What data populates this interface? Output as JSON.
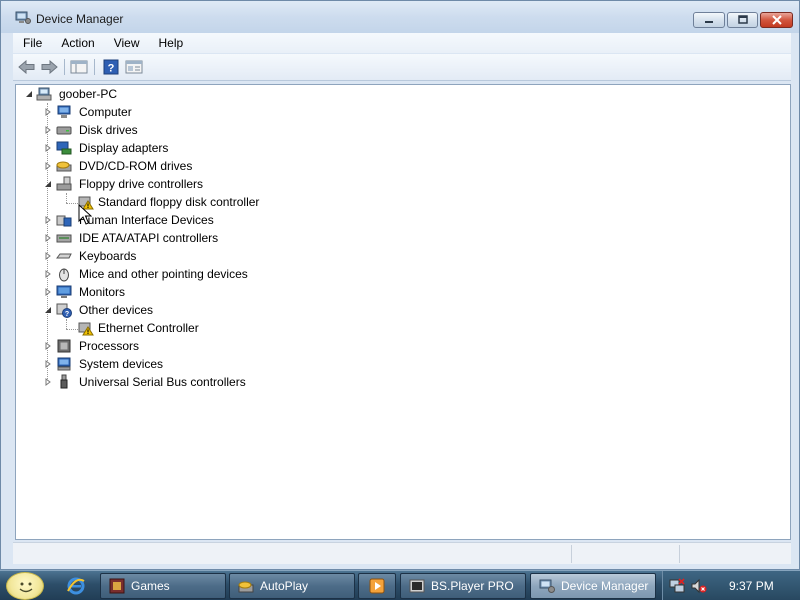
{
  "window": {
    "title": "Device Manager",
    "icon": "device-manager-icon",
    "controls": [
      "minimize-icon",
      "maximize-icon",
      "close-icon"
    ]
  },
  "menu": {
    "items": [
      "File",
      "Action",
      "View",
      "Help"
    ]
  },
  "toolbar": {
    "buttons": [
      "back-arrow-icon",
      "forward-arrow-icon",
      "show-hide-console-tree-icon",
      "help-icon",
      "properties-icon"
    ]
  },
  "tree": {
    "root": {
      "label": "goober-PC",
      "icon": "computer-icon",
      "expanded": true
    },
    "categories": [
      {
        "label": "Computer",
        "icon": "computer-icon",
        "expanded": false
      },
      {
        "label": "Disk drives",
        "icon": "disk-drive-icon",
        "expanded": false
      },
      {
        "label": "Display adapters",
        "icon": "display-adapter-icon",
        "expanded": false
      },
      {
        "label": "DVD/CD-ROM drives",
        "icon": "dvd-drive-icon",
        "expanded": false
      },
      {
        "label": "Floppy drive controllers",
        "icon": "floppy-controller-icon",
        "expanded": true,
        "children": [
          {
            "label": "Standard floppy disk controller",
            "icon": "warning-device-icon"
          }
        ]
      },
      {
        "label": "Human Interface Devices",
        "icon": "hid-icon",
        "expanded": false
      },
      {
        "label": "IDE ATA/ATAPI controllers",
        "icon": "ide-controller-icon",
        "expanded": false
      },
      {
        "label": "Keyboards",
        "icon": "keyboard-icon",
        "expanded": false
      },
      {
        "label": "Mice and other pointing devices",
        "icon": "mouse-icon",
        "expanded": false
      },
      {
        "label": "Monitors",
        "icon": "monitor-icon",
        "expanded": false
      },
      {
        "label": "Other devices",
        "icon": "unknown-device-icon",
        "expanded": true,
        "children": [
          {
            "label": "Ethernet Controller",
            "icon": "warning-device-icon"
          }
        ]
      },
      {
        "label": "Processors",
        "icon": "processor-icon",
        "expanded": false
      },
      {
        "label": "System devices",
        "icon": "system-device-icon",
        "expanded": false
      },
      {
        "label": "Universal Serial Bus controllers",
        "icon": "usb-icon",
        "expanded": false
      }
    ]
  },
  "taskbar": {
    "start_icon": "start-orb-icon",
    "quick_launch": [
      "internet-explorer-icon"
    ],
    "buttons": [
      {
        "label": "Games",
        "icon": "games-icon",
        "active": false
      },
      {
        "label": "AutoPlay",
        "icon": "autoplay-icon",
        "active": false
      },
      {
        "label": "",
        "icon": "media-player-icon",
        "active": false
      },
      {
        "label": "BS.Player PRO",
        "icon": "bsplayer-icon",
        "active": false
      },
      {
        "label": "Device Manager",
        "icon": "device-manager-icon",
        "active": true
      }
    ],
    "tray_icons": [
      "network-icon",
      "volume-muted-icon"
    ],
    "clock": "9:37 PM"
  },
  "colors": {
    "window_frame": "#dbe6f3",
    "taskbar": "#2d4e69",
    "close_button": "#c23a21",
    "warning": "#f2c200"
  }
}
